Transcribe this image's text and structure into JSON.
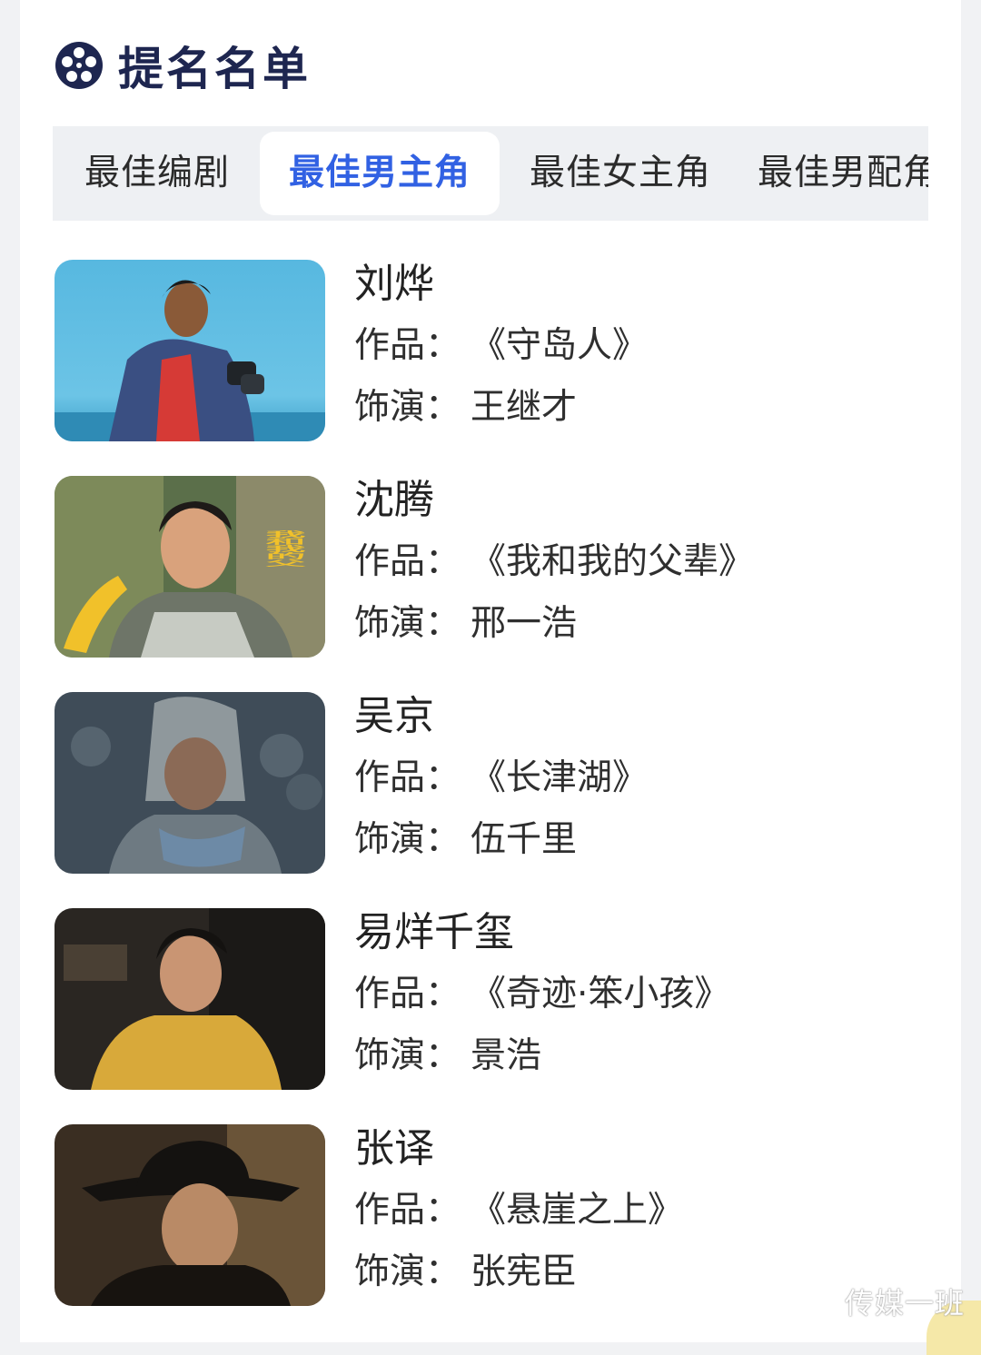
{
  "header": {
    "title": "提名名单",
    "icon": "film-reel-icon",
    "icon_color": "#1e2650"
  },
  "tabs": [
    {
      "label": "最佳编剧",
      "active": false
    },
    {
      "label": "最佳男主角",
      "active": true
    },
    {
      "label": "最佳女主角",
      "active": false
    },
    {
      "label": "最佳男配角",
      "active": false
    }
  ],
  "labels": {
    "work": "作品：",
    "role": "饰演："
  },
  "nominees": [
    {
      "name": "刘烨",
      "work": "《守岛人》",
      "role": "王继才"
    },
    {
      "name": "沈腾",
      "work": "《我和我的父辈》",
      "role": "邢一浩"
    },
    {
      "name": "吴京",
      "work": "《长津湖》",
      "role": "伍千里"
    },
    {
      "name": "易烊千玺",
      "work": "《奇迹·笨小孩》",
      "role": "景浩"
    },
    {
      "name": "张译",
      "work": "《悬崖之上》",
      "role": "张宪臣"
    }
  ],
  "poster_text": "我和我的父",
  "watermark": "传媒一班",
  "colors": {
    "accent": "#3161e3",
    "tab_bg": "#eef0f3",
    "title": "#1e2650"
  }
}
